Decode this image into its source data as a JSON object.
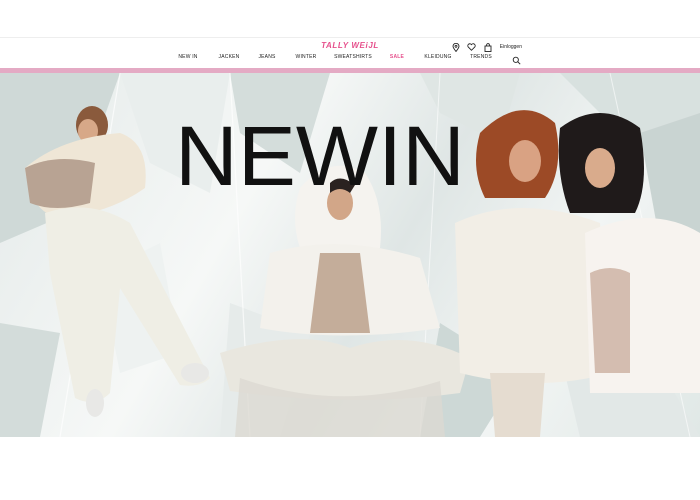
{
  "header": {
    "logo": "TALLY WEiJL",
    "login_label": "Einloggen",
    "icons": [
      "location-icon",
      "heart-icon",
      "bag-icon",
      "search-icon"
    ],
    "brand_color": "#e6508c",
    "accent_bar_color": "#e4aac4"
  },
  "nav": {
    "items": [
      {
        "label": "NEW IN"
      },
      {
        "label": "JACKEN"
      },
      {
        "label": "JEANS"
      },
      {
        "label": "WINTER"
      },
      {
        "label": "SWEATSHIRTS"
      },
      {
        "label": "SALE"
      },
      {
        "label": "KLEIDUNG"
      },
      {
        "label": "TRENDS"
      }
    ]
  },
  "hero": {
    "headline": "NEWIN"
  }
}
